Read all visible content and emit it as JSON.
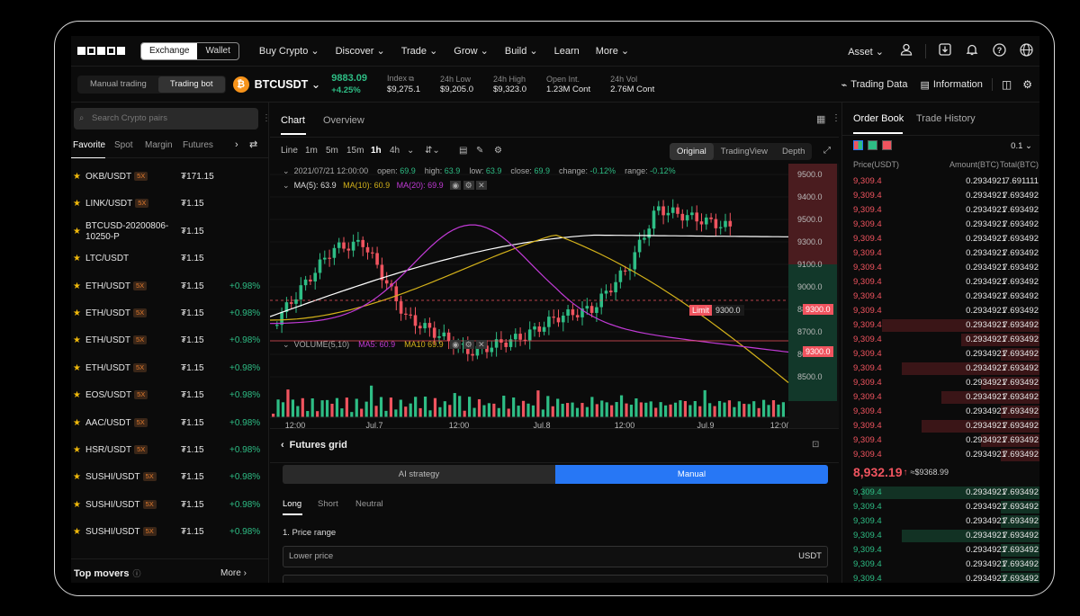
{
  "nav": {
    "logo": "OKX",
    "exchange_label": "Exchange",
    "wallet_label": "Wallet",
    "menu": [
      "Buy Crypto",
      "Discover",
      "Trade",
      "Grow",
      "Build",
      "Learn",
      "More"
    ],
    "menu_has_caret": [
      true,
      true,
      true,
      true,
      true,
      false,
      true
    ],
    "asset_label": "Asset"
  },
  "ticker": {
    "manual_trading": "Manual trading",
    "trading_bot": "Trading bot",
    "coin_symbol": "₿",
    "pair": "BTCUSDT",
    "last_price": "9883.09",
    "change_pct": "+4.25%",
    "stats": [
      {
        "label": "Index",
        "value": "$9,275.1"
      },
      {
        "label": "24h Low",
        "value": "$9,205.0"
      },
      {
        "label": "24h High",
        "value": "$9,323.0"
      },
      {
        "label": "Open Int.",
        "value": "1.23M Cont"
      },
      {
        "label": "24h Vol",
        "value": "2.76M Cont"
      }
    ],
    "trading_data": "Trading Data",
    "information": "Information"
  },
  "left": {
    "search_placeholder": "Search Crypto pairs",
    "tabs": [
      "Favorite",
      "Spot",
      "Margin",
      "Futures"
    ],
    "pairs": [
      {
        "name": "OKB/USDT",
        "badge": "5X",
        "price": "₮171.15",
        "change": ""
      },
      {
        "name": "LINK/USDT",
        "badge": "5X",
        "price": "₮1.15",
        "change": ""
      },
      {
        "name": "BTCUSD-20200806-",
        "name2": "10250-P",
        "badge": "",
        "price": "₮1.15",
        "change": ""
      },
      {
        "name": "LTC/USDT",
        "badge": "",
        "price": "₮1.15",
        "change": ""
      },
      {
        "name": "ETH/USDT",
        "badge": "5X",
        "price": "₮1.15",
        "change": "+0.98%"
      },
      {
        "name": "ETH/USDT",
        "badge": "5X",
        "price": "₮1.15",
        "change": "+0.98%"
      },
      {
        "name": "ETH/USDT",
        "badge": "5X",
        "price": "₮1.15",
        "change": "+0.98%"
      },
      {
        "name": "ETH/USDT",
        "badge": "5X",
        "price": "₮1.15",
        "change": "+0.98%"
      },
      {
        "name": "EOS/USDT",
        "badge": "5X",
        "price": "₮1.15",
        "change": "+0.98%"
      },
      {
        "name": "AAC/USDT",
        "badge": "5X",
        "price": "₮1.15",
        "change": "+0.98%"
      },
      {
        "name": "HSR/USDT",
        "badge": "5X",
        "price": "₮1.15",
        "change": "+0.98%"
      },
      {
        "name": "SUSHI/USDT",
        "badge": "5X",
        "price": "₮1.15",
        "change": "+0.98%"
      },
      {
        "name": "SUSHI/USDT",
        "badge": "5X",
        "price": "₮1.15",
        "change": "+0.98%"
      },
      {
        "name": "SUSHI/USDT",
        "badge": "5X",
        "price": "₮1.15",
        "change": "+0.98%"
      }
    ],
    "top_movers": "Top movers",
    "more": "More"
  },
  "chart": {
    "tab_chart": "Chart",
    "tab_overview": "Overview",
    "intervals": [
      "Line",
      "1m",
      "5m",
      "15m",
      "1h",
      "4h"
    ],
    "active_interval": "1h",
    "view_modes": [
      "Original",
      "TradingView",
      "Depth"
    ],
    "active_view": "Original",
    "ohlc_line": {
      "date": "2021/07/21 12:00:00",
      "open_label": "open:",
      "open": "69.9",
      "high_label": "high:",
      "high": "63.9",
      "low_label": "low:",
      "low": "63.9",
      "close_label": "close:",
      "close": "69.9",
      "change_label": "change:",
      "change": "-0.12%",
      "range_label": "range:",
      "range": "-0.12%"
    },
    "ma_line": {
      "ma5": "MA(5): 63.9",
      "ma10": "MA(10): 60.9",
      "ma20": "MA(20): 69.9"
    },
    "volume_line": {
      "label": "VOLUME(5,10)",
      "ma5": "MA5: 60.9",
      "ma10": "MA10 69.9"
    },
    "limit_label": "Limit",
    "limit_price": "9300.0",
    "line_price": "9300.0",
    "x_labels": [
      "12:00",
      "Jul.7",
      "12:00",
      "Jul.8",
      "12:00",
      "Jul.9",
      "12:0("
    ],
    "y_labels": [
      "9500.0",
      "9400.0",
      "9500.0",
      "9300.0",
      "9100.0",
      "9000.0",
      "8800.0",
      "8700.0",
      "8600.0",
      "8500.0"
    ],
    "colors": {
      "up": "#2ebd85",
      "down": "#f0545f",
      "ma5": "#ffffff",
      "ma10": "#d4b21a",
      "ma20": "#c13ad6"
    }
  },
  "futures": {
    "title": "Futures grid",
    "ai_strategy": "AI strategy",
    "manual": "Manual",
    "tabs": [
      "Long",
      "Short",
      "Neutral"
    ],
    "price_range": "1. Price range",
    "lower_price": "Lower price",
    "unit": "USDT"
  },
  "orderbook": {
    "tab_order_book": "Order Book",
    "tab_trade_history": "Trade History",
    "precision": "0.1",
    "col_price": "Price(USDT)",
    "col_amount": "Amount(BTC)",
    "col_total": "Total(BTC)",
    "asks": [
      {
        "price": "9,309.4",
        "amount": "0.2934921",
        "total": "7.691111",
        "depth": 0
      },
      {
        "price": "9,309.4",
        "amount": "0.2934921",
        "total": "7.693492",
        "depth": 0
      },
      {
        "price": "9,309.4",
        "amount": "0.2934921",
        "total": "7.693492",
        "depth": 0
      },
      {
        "price": "9,309.4",
        "amount": "0.2934921",
        "total": "7.693492",
        "depth": 0
      },
      {
        "price": "9,309.4",
        "amount": "0.2934921",
        "total": "7.693492",
        "depth": 0
      },
      {
        "price": "9,309.4",
        "amount": "0.2934921",
        "total": "7.693492",
        "depth": 0
      },
      {
        "price": "9,309.4",
        "amount": "0.2934921",
        "total": "7.693492",
        "depth": 0
      },
      {
        "price": "9,309.4",
        "amount": "0.2934921",
        "total": "7.693492",
        "depth": 0
      },
      {
        "price": "9,309.4",
        "amount": "0.2934921",
        "total": "7.693492",
        "depth": 0
      },
      {
        "price": "9,309.4",
        "amount": "0.2934921",
        "total": "7.693492",
        "depth": 0
      },
      {
        "price": "9,309.4",
        "amount": "0.2934921",
        "total": "7.693492",
        "depth": 0.8
      },
      {
        "price": "9,309.4",
        "amount": "0.2934921",
        "total": "7.693492",
        "depth": 0.4
      },
      {
        "price": "9,309.4",
        "amount": "0.2934921",
        "total": "7.693492",
        "depth": 0.2
      },
      {
        "price": "9,309.4",
        "amount": "0.2934921",
        "total": "7.693492",
        "depth": 0.7
      },
      {
        "price": "9,309.4",
        "amount": "0.2934921",
        "total": "7.693492",
        "depth": 0.3
      },
      {
        "price": "9,309.4",
        "amount": "0.2934921",
        "total": "7.693492",
        "depth": 0.5
      },
      {
        "price": "9,309.4",
        "amount": "0.2934921",
        "total": "7.693492",
        "depth": 0.2
      },
      {
        "price": "9,309.4",
        "amount": "0.2934921",
        "total": "7.693492",
        "depth": 0.6
      },
      {
        "price": "9,309.4",
        "amount": "0.2934921",
        "total": "7.693492",
        "depth": 0.3
      },
      {
        "price": "9,309.4",
        "amount": "0.2934921",
        "total": "7.693492",
        "depth": 0.2
      }
    ],
    "mid_price": "8,932.19",
    "mid_arrow": "↑",
    "mid_ref": "≈$9368.99",
    "bids": [
      {
        "price": "9,309.4",
        "amount": "0.2934921",
        "total": "7.693492",
        "depth": 0.9
      },
      {
        "price": "9,309.4",
        "amount": "0.2934921",
        "total": "7.693492",
        "depth": 0.2
      },
      {
        "price": "9,309.4",
        "amount": "0.2934921",
        "total": "7.693492",
        "depth": 0.2
      },
      {
        "price": "9,309.4",
        "amount": "0.2934921",
        "total": "7.693492",
        "depth": 0.7
      },
      {
        "price": "9,309.4",
        "amount": "0.2934921",
        "total": "7.693492",
        "depth": 0.2
      },
      {
        "price": "9,309.4",
        "amount": "0.2934921",
        "total": "7.693492",
        "depth": 0.2
      },
      {
        "price": "9,309.4",
        "amount": "0.2934921",
        "total": "7.693492",
        "depth": 0.2
      },
      {
        "price": "9,309.4",
        "amount": "0.2934921",
        "total": "7.693492",
        "depth": 0.2
      },
      {
        "price": "9,309.4",
        "amount": "0.2934921",
        "total": "7.693492",
        "depth": 0.2
      },
      {
        "price": "9,309.4",
        "amount": "0.2934921",
        "total": "7.693492",
        "depth": 0.2
      }
    ]
  }
}
